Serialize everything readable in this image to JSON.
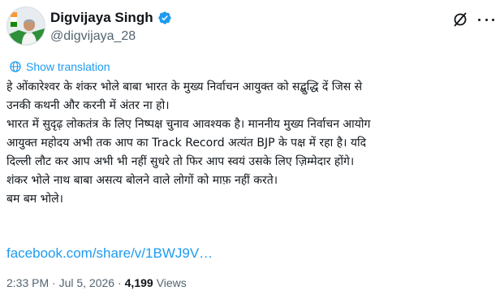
{
  "author": {
    "name": "Digvijaya Singh",
    "handle": "@digvijaya_28",
    "verified_color": "#1d9bf0"
  },
  "translation": {
    "label": "Show translation",
    "icon": "globe-icon"
  },
  "body": {
    "lines": [
      "हे ओंकारेश्वर के शंकर भोले बाबा भारत के मुख्य निर्वाचन आयुक्त को सद्बुद्धि दें जिस से",
      "उनकी कथनी और करनी में अंतर ना हो।",
      "भारत में सुदृढ़ लोकतंत्र के लिए निष्पक्ष चुनाव आवश्यक है। माननीय मुख्य निर्वाचन आयोग",
      "आयुक्त महोदय अभी तक आप का Track Record अत्यंत BJP के पक्ष में रहा है। यदि",
      "दिल्ली लौट कर आप अभी भी नहीं सुधरे तो फिर आप स्वयं उसके लिए ज़िम्मेदार होंगे।",
      "शंकर भोले नाथ बाबा असत्य बोलने वाले लोगों को माफ़ नहीं करते।",
      "बम बम भोले।"
    ]
  },
  "link": {
    "text": "facebook.com/share/v/1BWJ9V…"
  },
  "meta": {
    "time_date": "2:33 PM · Jul 5, 2026 ·",
    "views_count": "4,199",
    "views_label": "Views"
  },
  "colors": {
    "accent": "#1d9bf0",
    "text": "#0f1419",
    "secondary": "#536471"
  },
  "icons": {
    "grok": "grok-icon",
    "more": "more-icon",
    "verified": "verified-badge-icon"
  }
}
